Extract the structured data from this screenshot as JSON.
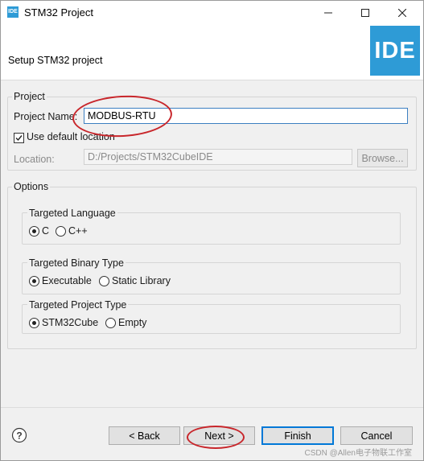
{
  "window": {
    "title": "STM32 Project",
    "icon": "ide-app-icon",
    "icon_text": "IDE"
  },
  "header": {
    "title": "Setup STM32 project",
    "logo_text": "IDE",
    "logo_color": "#2e9bd6"
  },
  "project_group": {
    "label": "Project",
    "name_label": "Project Name:",
    "name_value": "MODBUS-RTU",
    "use_default_label": "Use default location",
    "use_default_checked": true,
    "location_label": "Location:",
    "location_value": "D:/Projects/STM32CubeIDE",
    "browse_label": "Browse..."
  },
  "options_group": {
    "label": "Options",
    "language": {
      "label": "Targeted Language",
      "options": [
        "C",
        "C++"
      ],
      "selected": "C"
    },
    "binary_type": {
      "label": "Targeted Binary Type",
      "options": [
        "Executable",
        "Static Library"
      ],
      "selected": "Executable"
    },
    "project_type": {
      "label": "Targeted Project Type",
      "options": [
        "STM32Cube",
        "Empty"
      ],
      "selected": "STM32Cube"
    }
  },
  "footer": {
    "back_label": "< Back",
    "next_label": "Next >",
    "finish_label": "Finish",
    "cancel_label": "Cancel"
  },
  "watermark": "CSDN @Allen电子物联工作室",
  "colors": {
    "accent": "#2e9bd6",
    "annotation": "#c8262b",
    "focus": "#0078d7"
  }
}
